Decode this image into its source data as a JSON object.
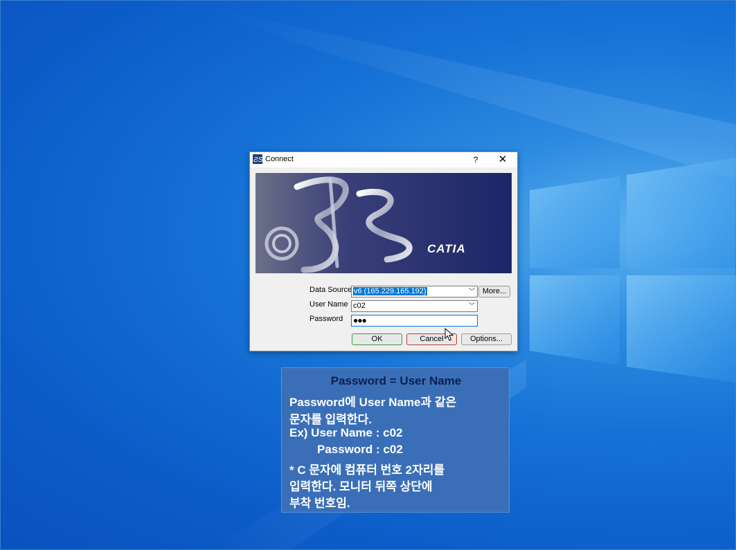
{
  "dialog": {
    "title": "Connect",
    "help_label": "?",
    "close_label": "✕",
    "banner_logo": "CATIA",
    "data_source_label": "Data Source",
    "data_source_value": "v6 (165.229.165.192)",
    "more_label": "More...",
    "user_name_label": "User Name",
    "user_name_value": "c02",
    "password_label": "Password",
    "password_value": "●●●",
    "ok_label": "OK",
    "cancel_label": "Cancel",
    "options_label": "Options..."
  },
  "note": {
    "heading": "Password = User Name",
    "lines": [
      "Password에 User Name과 같은",
      "문자를 입력한다.",
      "Ex) User Name : c02",
      "Password : c02",
      "* C 문자에 컴퓨터 번호 2자리를",
      "입력한다. 모니터 뒤쪽 상단에",
      "부착 번호임."
    ]
  },
  "icons": {
    "title_icon": "ds-logo-icon",
    "dropdown": "chevron-down-icon",
    "cursor": "mouse-pointer-icon"
  },
  "colors": {
    "desktop": "#1672d6",
    "selection": "#0078d7",
    "note_bg": "#3a6fb8",
    "banner": "#28306a"
  }
}
